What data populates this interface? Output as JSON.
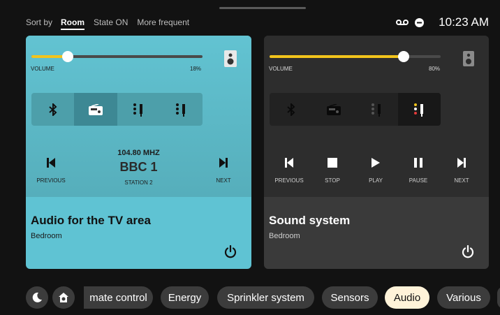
{
  "topbar": {
    "sort_label": "Sort by",
    "sort_options": [
      {
        "label": "Room",
        "active": true
      },
      {
        "label": "State ON",
        "active": false
      },
      {
        "label": "More frequent",
        "active": false
      }
    ],
    "status_icons": [
      "voicemail-icon",
      "do-not-disturb-icon"
    ],
    "time": "10:23 AM"
  },
  "cards": {
    "left": {
      "volume_label": "VOLUME",
      "volume_value": "18%",
      "volume_level": 0.18,
      "sources": [
        "bluetooth-icon",
        "radio-icon",
        "aux-input-icon",
        "rca-input-icon"
      ],
      "active_source": 1,
      "frequency": "104.80 MHZ",
      "station": "BBC 1",
      "station_sub": "STATION 2",
      "prev_label": "PREVIOUS",
      "next_label": "NEXT",
      "title": "Audio for the TV area",
      "room": "Bedroom",
      "accent": "#5fc3d3"
    },
    "right": {
      "volume_label": "VOLUME",
      "volume_value": "80%",
      "volume_level": 0.8,
      "sources": [
        "bluetooth-icon",
        "radio-icon",
        "aux-input-icon",
        "rca-input-icon"
      ],
      "active_source": 3,
      "controls": [
        "PREVIOUS",
        "STOP",
        "PLAY",
        "PAUSE",
        "NEXT"
      ],
      "title": "Sound system",
      "room": "Bedroom",
      "accent": "#3a3a3a"
    }
  },
  "categories": {
    "round_buttons": [
      "night-mode-icon",
      "home-scene-icon"
    ],
    "chips": [
      {
        "label": "mate control",
        "active": false
      },
      {
        "label": "Energy",
        "active": false
      },
      {
        "label": "Sprinkler system",
        "active": false
      },
      {
        "label": "Sensors",
        "active": false
      },
      {
        "label": "Audio",
        "active": true
      },
      {
        "label": "Various",
        "active": false
      }
    ]
  },
  "colors": {
    "background": "#121212",
    "slider_fill": "#f2c41c",
    "chip": "#3c3c3c",
    "chip_active": "#fff3d9"
  }
}
